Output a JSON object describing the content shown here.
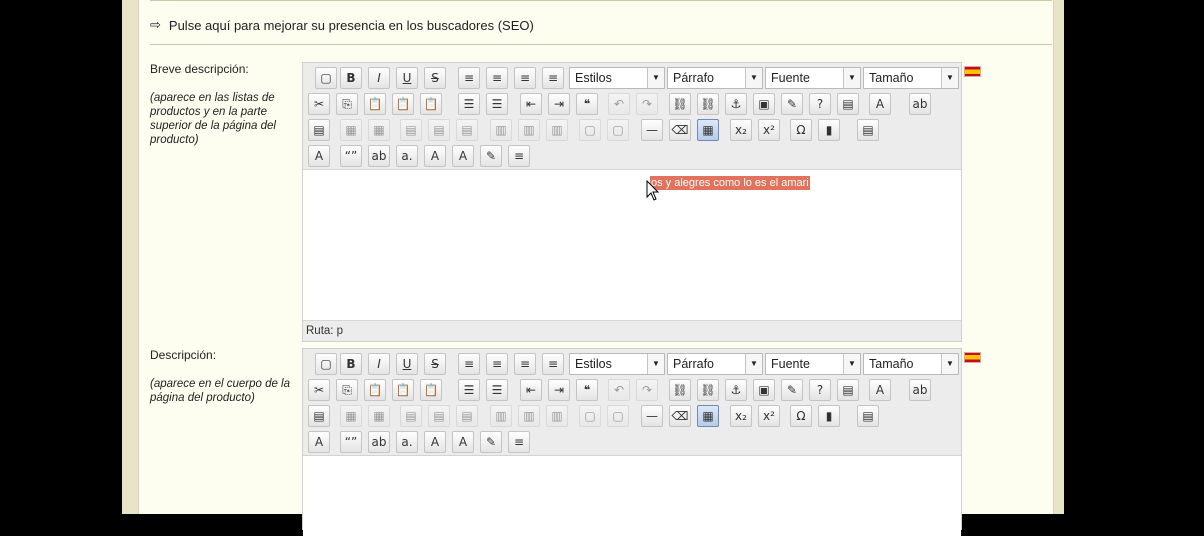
{
  "seo_link": "Pulse aquí para mejorar su presencia en los buscadores (SEO)",
  "short_desc": {
    "label": "Breve descripción:",
    "hint": "(aparece en las listas de productos y en la parte superior de la página del producto)",
    "status": "Ruta: p",
    "selected_text": "os y alegres como lo es el amari"
  },
  "long_desc": {
    "label": "Descripción:",
    "hint": "(aparece en el cuerpo de la página del producto)"
  },
  "toolbar": {
    "styles": "Estilos",
    "format": "Párrafo",
    "font": "Fuente",
    "size": "Tamaño"
  },
  "flag": "es-flag",
  "colors": {
    "selection": "#e2725b",
    "panel": "#fdfdf0"
  }
}
